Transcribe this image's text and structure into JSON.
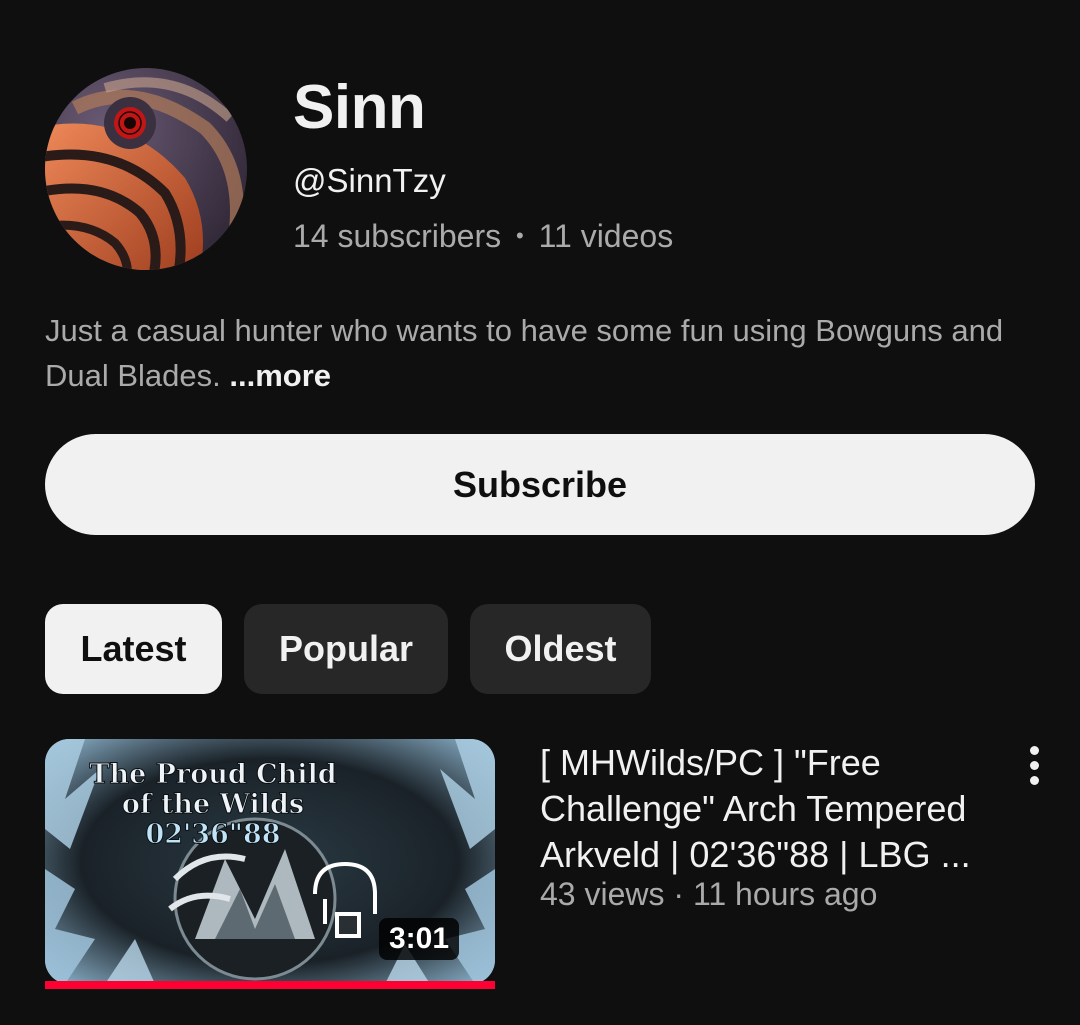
{
  "channel": {
    "name": "Sinn",
    "handle": "@SinnTzy",
    "subscribers": "14 subscribers",
    "separator": "•",
    "videos": "11 videos",
    "description": "Just a casual hunter who wants to have some fun using Bowguns and Dual Blades.",
    "more_label": "...more",
    "avatar_icon": "sharingan-mask-avatar"
  },
  "subscribe_label": "Subscribe",
  "chips": [
    {
      "label": "Latest",
      "active": true
    },
    {
      "label": "Popular",
      "active": false
    },
    {
      "label": "Oldest",
      "active": false
    }
  ],
  "video": {
    "title": "[ MHWilds/PC ] \"Free Challenge\" Arch Tempered Arkveld | 02'36\"88 | LBG ...",
    "views": "43 views",
    "meta_separator": "·",
    "age": "11 hours ago",
    "duration": "3:01",
    "watched_fraction": 1.0,
    "thumbnail": {
      "line1": "The Proud Child",
      "line2": "of the Wilds",
      "line3": "02'36\"88"
    },
    "menu_icon": "more-vert-icon"
  },
  "colors": {
    "background": "#0f0f0f",
    "progress": "#ff0033",
    "secondary_text": "#aaaaaa"
  }
}
